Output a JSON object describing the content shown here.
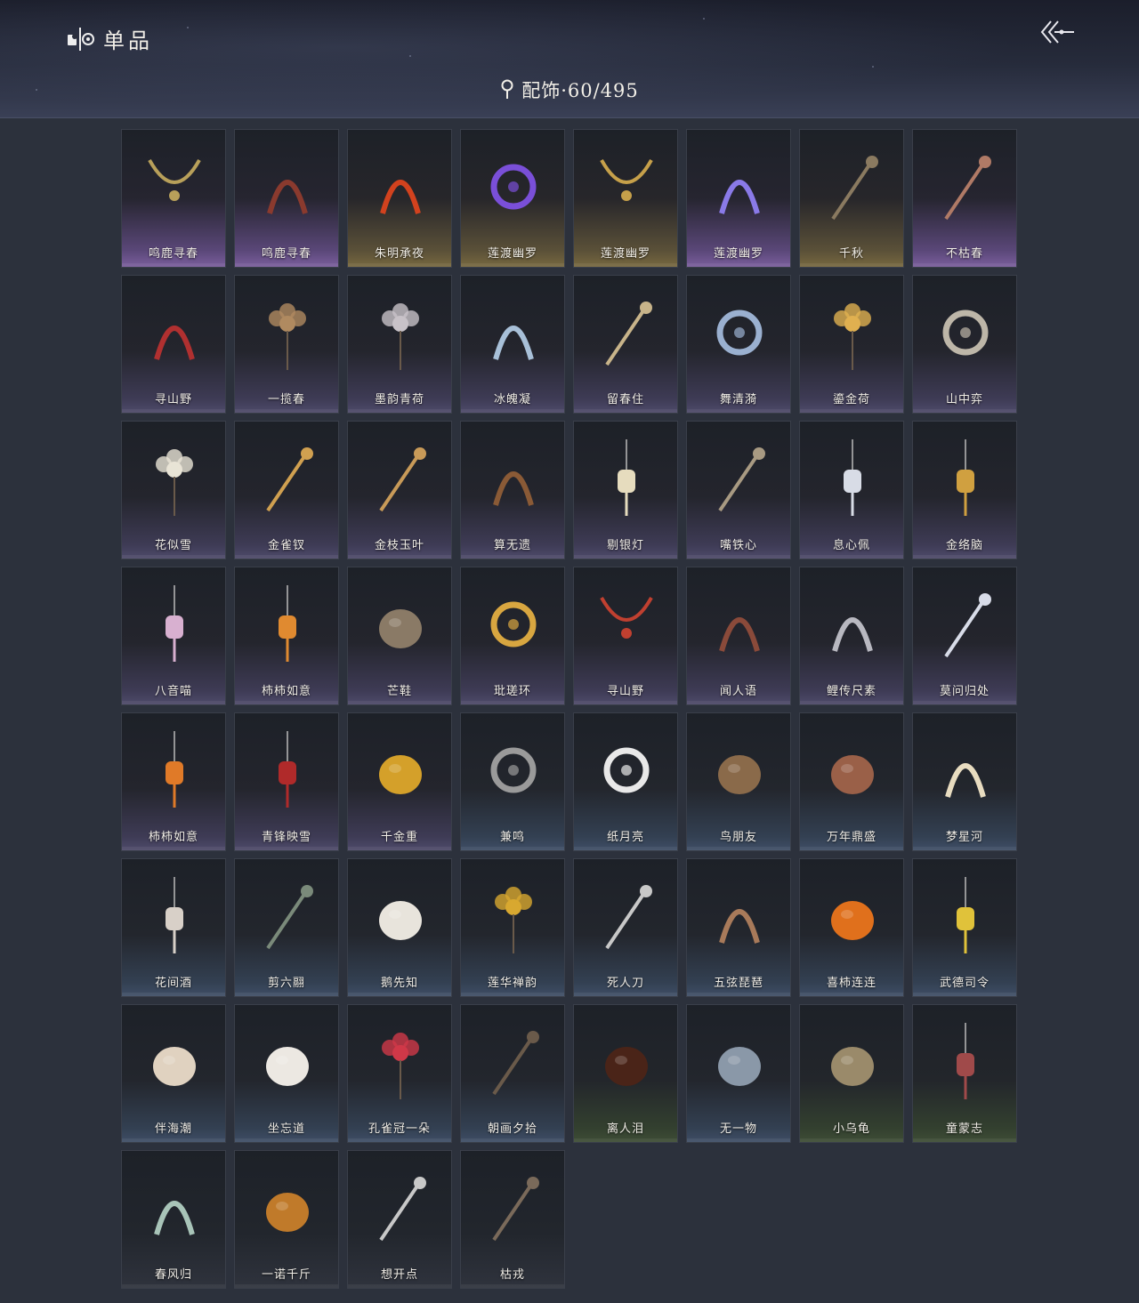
{
  "header": {
    "title": "单品",
    "category_label": "配饰·60/495"
  },
  "items": [
    {
      "name": "鸣鹿寻春",
      "rarity": "purple",
      "icon": "necklace-icon",
      "color": "#b8a05a"
    },
    {
      "name": "鸣鹿寻春",
      "rarity": "purple",
      "icon": "makeup-icon",
      "color": "#8a3a2e"
    },
    {
      "name": "朱明承夜",
      "rarity": "gold",
      "icon": "flame-wing-icon",
      "color": "#d2421e"
    },
    {
      "name": "莲渡幽罗",
      "rarity": "gold",
      "icon": "purple-ring-icon",
      "color": "#7a4fd8"
    },
    {
      "name": "莲渡幽罗",
      "rarity": "gold",
      "icon": "gold-necklace-icon",
      "color": "#c6a04a"
    },
    {
      "name": "莲渡幽罗",
      "rarity": "purple",
      "icon": "spirit-horns-icon",
      "color": "#8a7ae8"
    },
    {
      "name": "千秋",
      "rarity": "gold",
      "icon": "fan-icon",
      "color": "#8a7a60"
    },
    {
      "name": "不枯春",
      "rarity": "purple",
      "icon": "hairpin-icon",
      "color": "#b07a66"
    },
    {
      "name": "寻山野",
      "rarity": "violet",
      "icon": "bead-bracelet-icon",
      "color": "#b03030"
    },
    {
      "name": "一揽春",
      "rarity": "violet",
      "icon": "flower-basket-icon",
      "color": "#b08a60"
    },
    {
      "name": "墨韵青荷",
      "rarity": "violet",
      "icon": "lotus-icon",
      "color": "#c8c2c8"
    },
    {
      "name": "冰魄凝",
      "rarity": "violet",
      "icon": "ice-crown-icon",
      "color": "#a8c0d8"
    },
    {
      "name": "留春住",
      "rarity": "violet",
      "icon": "branch-hairpin-icon",
      "color": "#c8b48a"
    },
    {
      "name": "舞清漪",
      "rarity": "violet",
      "icon": "feather-earrings-icon",
      "color": "#9ab0d0"
    },
    {
      "name": "鎏金荷",
      "rarity": "violet",
      "icon": "gold-sprigs-icon",
      "color": "#e0b050"
    },
    {
      "name": "山中弈",
      "rarity": "violet",
      "icon": "go-board-icon",
      "color": "#bdb6a8"
    },
    {
      "name": "花似雪",
      "rarity": "violet",
      "icon": "white-flower-icon",
      "color": "#e8e4d6"
    },
    {
      "name": "金雀钗",
      "rarity": "violet",
      "icon": "gold-bird-pin-icon",
      "color": "#d0a050"
    },
    {
      "name": "金枝玉叶",
      "rarity": "violet",
      "icon": "gold-stick-pin-icon",
      "color": "#c89a58"
    },
    {
      "name": "算无遗",
      "rarity": "violet",
      "icon": "abacus-icon",
      "color": "#8a5a36"
    },
    {
      "name": "剔银灯",
      "rarity": "violet",
      "icon": "lantern-icon",
      "color": "#e6dcbe"
    },
    {
      "name": "嘴铁心",
      "rarity": "violet",
      "icon": "dragon-blade-icon",
      "color": "#a89a82"
    },
    {
      "name": "息心佩",
      "rarity": "violet",
      "icon": "jade-pendant-icon",
      "color": "#d8dce6"
    },
    {
      "name": "金络脑",
      "rarity": "violet",
      "icon": "gold-horse-pendant-icon",
      "color": "#d0a040"
    },
    {
      "name": "八音喵",
      "rarity": "violet",
      "icon": "cat-pendant-icon",
      "color": "#d8b0d0"
    },
    {
      "name": "柿柿如意",
      "rarity": "violet",
      "icon": "orange-charm-icon",
      "color": "#e08a30"
    },
    {
      "name": "芒鞋",
      "rarity": "violet",
      "icon": "straw-sandals-icon",
      "color": "#8a7a66"
    },
    {
      "name": "玭瑳环",
      "rarity": "violet",
      "icon": "gold-ring-pendant-icon",
      "color": "#d8a640"
    },
    {
      "name": "寻山野",
      "rarity": "violet",
      "icon": "bead-necklace-icon",
      "color": "#c04030"
    },
    {
      "name": "闻人语",
      "rarity": "violet",
      "icon": "fox-ears-icon",
      "color": "#8a4a3a"
    },
    {
      "name": "鲤传尺素",
      "rarity": "violet",
      "icon": "silver-crown-icon",
      "color": "#b8b8c0"
    },
    {
      "name": "莫问归处",
      "rarity": "violet",
      "icon": "blossom-pin-icon",
      "color": "#d8dce8"
    },
    {
      "name": "柿柿如意",
      "rarity": "violet",
      "icon": "persimmon-tassel-icon",
      "color": "#e07a28"
    },
    {
      "name": "青锋映雪",
      "rarity": "violet",
      "icon": "red-tassel-icon",
      "color": "#b02a2a"
    },
    {
      "name": "千金重",
      "rarity": "violet",
      "icon": "gold-ingot-bird-icon",
      "color": "#d4a02a"
    },
    {
      "name": "兼鸣",
      "rarity": "blue",
      "icon": "gear-ornament-icon",
      "color": "#9a9a9a"
    },
    {
      "name": "纸月亮",
      "rarity": "blue",
      "icon": "paper-moon-icon",
      "color": "#e8e8e8"
    },
    {
      "name": "鸟朋友",
      "rarity": "blue",
      "icon": "bird-house-icon",
      "color": "#8a6a4a"
    },
    {
      "name": "万年鼎盛",
      "rarity": "blue",
      "icon": "turtle-cauldron-icon",
      "color": "#9a6048"
    },
    {
      "name": "梦星河",
      "rarity": "blue",
      "icon": "floral-boat-icon",
      "color": "#e8dcc0"
    },
    {
      "name": "花间酒",
      "rarity": "blue",
      "icon": "gourd-pendant-icon",
      "color": "#d8d0c8"
    },
    {
      "name": "剪六翮",
      "rarity": "blue",
      "icon": "dagger-icon",
      "color": "#7a8a7a"
    },
    {
      "name": "鹅先知",
      "rarity": "blue",
      "icon": "goose-icon",
      "color": "#e8e4dc"
    },
    {
      "name": "莲华禅韵",
      "rarity": "blue",
      "icon": "gold-lotus-icon",
      "color": "#d8a830"
    },
    {
      "name": "死人刀",
      "rarity": "blue",
      "icon": "saber-icon",
      "color": "#c8c8c8"
    },
    {
      "name": "五弦琵琶",
      "rarity": "blue",
      "icon": "pipa-icon",
      "color": "#a87a5a"
    },
    {
      "name": "喜柿连连",
      "rarity": "blue",
      "icon": "persimmons-icon",
      "color": "#e0701c"
    },
    {
      "name": "武德司令",
      "rarity": "blue",
      "icon": "token-icon",
      "color": "#e0c23a"
    },
    {
      "name": "伴海潮",
      "rarity": "blue",
      "icon": "starfish-icon",
      "color": "#e0d2c0"
    },
    {
      "name": "坐忘道",
      "rarity": "blue",
      "icon": "mask-icon",
      "color": "#ece8e2"
    },
    {
      "name": "孔雀冠一朵",
      "rarity": "blue",
      "icon": "red-flower-icon",
      "color": "#d03848"
    },
    {
      "name": "朝画夕拾",
      "rarity": "blue",
      "icon": "brush-icon",
      "color": "#6a5a4a"
    },
    {
      "name": "离人泪",
      "rarity": "green",
      "icon": "wine-jar-icon",
      "color": "#4a2418"
    },
    {
      "name": "无一物",
      "rarity": "blue",
      "icon": "cloth-pouch-icon",
      "color": "#8a98a8"
    },
    {
      "name": "小乌龟",
      "rarity": "green",
      "icon": "turtle-icon",
      "color": "#9a8a6a"
    },
    {
      "name": "童蒙志",
      "rarity": "green",
      "icon": "ribbon-icon",
      "color": "#a04a4a"
    },
    {
      "name": "春风归",
      "rarity": "grey",
      "icon": "swallow-kite-icon",
      "color": "#a8c4b8"
    },
    {
      "name": "一诺千斤",
      "rarity": "grey",
      "icon": "roast-chicken-icon",
      "color": "#c07a2a"
    },
    {
      "name": "想开点",
      "rarity": "grey",
      "icon": "kitchen-knife-icon",
      "color": "#c8c8c8"
    },
    {
      "name": "枯戎",
      "rarity": "grey",
      "icon": "dry-branch-icon",
      "color": "#7a6a5a"
    }
  ]
}
